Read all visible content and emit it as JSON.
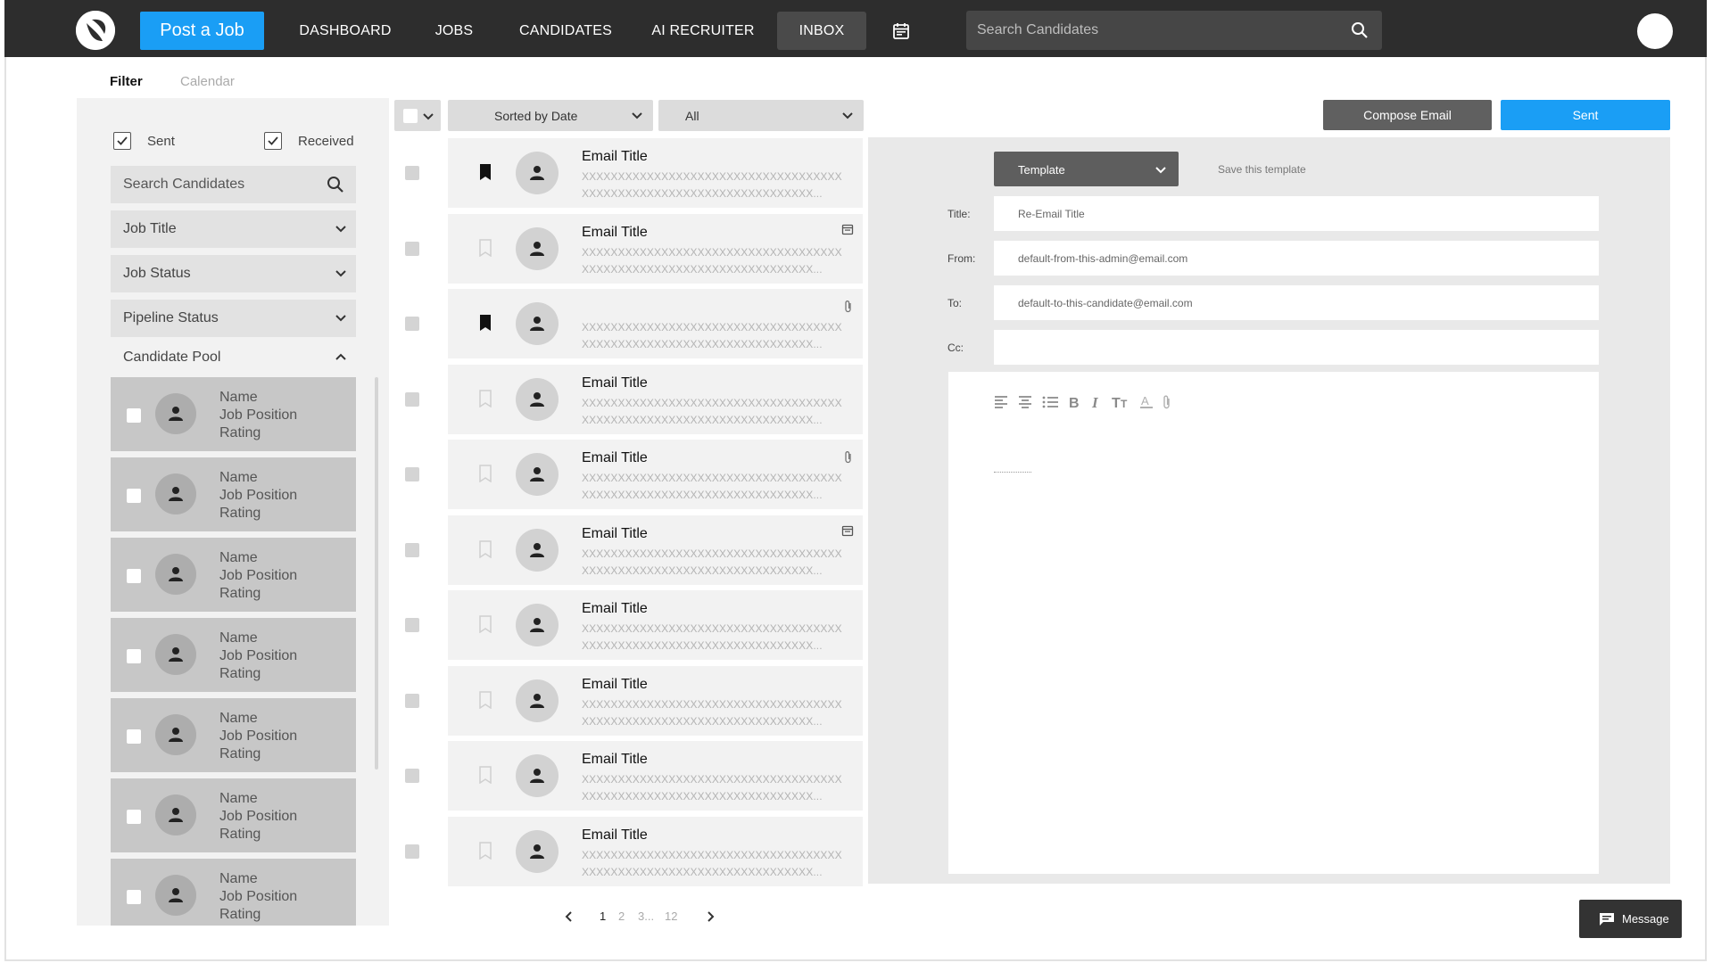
{
  "header": {
    "post_job": "Post a Job",
    "nav": [
      "DASHBOARD",
      "JOBS",
      "CANDIDATES",
      "AI RECRUITER",
      "INBOX"
    ],
    "active_nav": "INBOX",
    "search_placeholder": "Search Candidates",
    "brand_color": "#1a9ef5"
  },
  "filter_tabs": {
    "filter": "Filter",
    "calendar": "Calendar"
  },
  "sidebar": {
    "sent_label": "Sent",
    "received_label": "Received",
    "sent_checked": true,
    "received_checked": true,
    "search_placeholder": "Search Candidates",
    "dropdowns": [
      "Job Title",
      "Job Status",
      "Pipeline Status"
    ],
    "pool_title": "Candidate Pool",
    "pool": [
      {
        "name": "Name",
        "position": "Job Position",
        "rating": "Rating"
      },
      {
        "name": "Name",
        "position": "Job Position",
        "rating": "Rating"
      },
      {
        "name": "Name",
        "position": "Job Position",
        "rating": "Rating"
      },
      {
        "name": "Name",
        "position": "Job Position",
        "rating": "Rating"
      },
      {
        "name": "Name",
        "position": "Job Position",
        "rating": "Rating"
      },
      {
        "name": "Name",
        "position": "Job Position",
        "rating": "Rating"
      },
      {
        "name": "Name",
        "position": "Job Position",
        "rating": "Rating"
      }
    ]
  },
  "toolbar": {
    "sort": "Sorted by Date",
    "filter": "All"
  },
  "emails": [
    {
      "title": "Email Title",
      "line1": "XXXXXXXXXXXXXXXXXXXXXXXXXXXXXXXXXXXX",
      "line2": "XXXXXXXXXXXXXXXXXXXXXXXXXXXXXXXX...",
      "bookmarked": true,
      "icon": ""
    },
    {
      "title": "Email Title",
      "line1": "XXXXXXXXXXXXXXXXXXXXXXXXXXXXXXXXXXXX",
      "line2": "XXXXXXXXXXXXXXXXXXXXXXXXXXXXXXXX...",
      "bookmarked": false,
      "icon": "calendar-icon"
    },
    {
      "title": "",
      "line1": "XXXXXXXXXXXXXXXXXXXXXXXXXXXXXXXXXXXX",
      "line2": "XXXXXXXXXXXXXXXXXXXXXXXXXXXXXXXX...",
      "bookmarked": true,
      "icon": "attachment-icon"
    },
    {
      "title": "Email Title",
      "line1": "XXXXXXXXXXXXXXXXXXXXXXXXXXXXXXXXXXXX",
      "line2": "XXXXXXXXXXXXXXXXXXXXXXXXXXXXXXXX...",
      "bookmarked": false,
      "icon": ""
    },
    {
      "title": "Email Title",
      "line1": "XXXXXXXXXXXXXXXXXXXXXXXXXXXXXXXXXXXX",
      "line2": "XXXXXXXXXXXXXXXXXXXXXXXXXXXXXXXX...",
      "bookmarked": false,
      "icon": "attachment-icon"
    },
    {
      "title": "Email Title",
      "line1": "XXXXXXXXXXXXXXXXXXXXXXXXXXXXXXXXXXXX",
      "line2": "XXXXXXXXXXXXXXXXXXXXXXXXXXXXXXXX...",
      "bookmarked": false,
      "icon": "calendar-icon"
    },
    {
      "title": "Email Title",
      "line1": "XXXXXXXXXXXXXXXXXXXXXXXXXXXXXXXXXXXX",
      "line2": "XXXXXXXXXXXXXXXXXXXXXXXXXXXXXXXX...",
      "bookmarked": false,
      "icon": ""
    },
    {
      "title": "Email Title",
      "line1": "XXXXXXXXXXXXXXXXXXXXXXXXXXXXXXXXXXXX",
      "line2": "XXXXXXXXXXXXXXXXXXXXXXXXXXXXXXXX...",
      "bookmarked": false,
      "icon": ""
    },
    {
      "title": "Email Title",
      "line1": "XXXXXXXXXXXXXXXXXXXXXXXXXXXXXXXXXXXX",
      "line2": "XXXXXXXXXXXXXXXXXXXXXXXXXXXXXXXX...",
      "bookmarked": false,
      "icon": ""
    },
    {
      "title": "Email Title",
      "line1": "XXXXXXXXXXXXXXXXXXXXXXXXXXXXXXXXXXXX",
      "line2": "XXXXXXXXXXXXXXXXXXXXXXXXXXXXXXXX...",
      "bookmarked": false,
      "icon": ""
    }
  ],
  "pagination": {
    "pages": [
      "1",
      "2",
      "3...",
      "12"
    ],
    "current": "1"
  },
  "compose": {
    "compose_label": "Compose Email",
    "sent_label": "Sent",
    "template_label": "Template",
    "save_template": "Save this template",
    "title_label": "Title:",
    "title_value": "Re-Email Title",
    "from_label": "From:",
    "from_value": "default-from-this-admin@email.com",
    "to_label": "To:",
    "to_value": "default-to-this-candidate@email.com",
    "cc_label": "Cc:",
    "cc_value": "",
    "tools": [
      "align-left-icon",
      "align-center-icon",
      "bullet-list-icon",
      "bold-icon",
      "italic-icon",
      "text-size-icon",
      "font-color-icon",
      "attachment-icon"
    ]
  },
  "message_button": "Message"
}
